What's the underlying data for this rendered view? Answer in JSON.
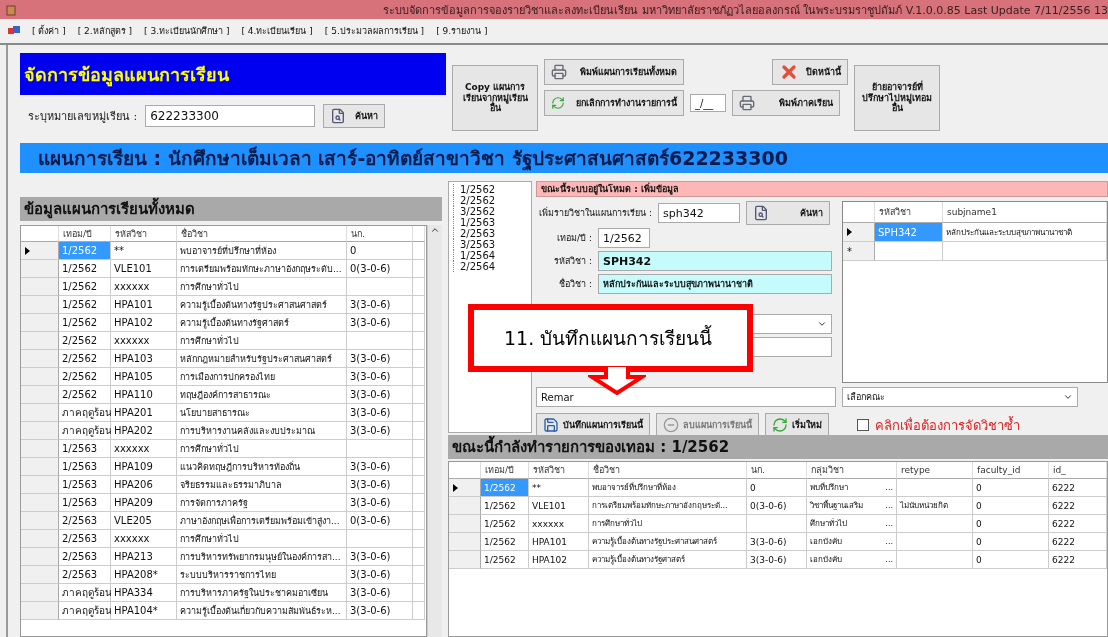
{
  "title_bar": {
    "title": "ระบบจัดการข้อมูลการจองรายวิชาและลงทะเบียนเรียน มหาวิทยาลัยราชภัฏวไลยอลงกรณ์ ในพระบรมราชูปถัมภ์ V.1.0.0.85 Last Update 7/11/2556 13"
  },
  "menu": [
    "[ ตั้งค่า ]",
    "[ 2.หลักสูตร ]",
    "[ 3.ทะเบียนนักศึกษา ]",
    "[ 4.ทะเบียนเรียน ]",
    "[ 5.ประมวลผลการเรียน ]",
    "[ 9.รายงาน ]"
  ],
  "header": {
    "title": "จัดการข้อมูลแผนการเรียน",
    "group_label": "ระบุหมายเลขหมู่เรียน :",
    "group_value": "622233300",
    "search_button": "ค้นหา"
  },
  "toolbar": {
    "copy_button": "Copy แผนการเรียนจากหมู่เรียนอื่น",
    "print_all_button": "พิมพ์แผนการเรียนทั้งหมด",
    "cancel_button": "ยกเลิกการทำงานรายการนี้",
    "term_field": "_/__",
    "print_term_button": "พิมพ์ภาคเรียน",
    "close_button": "ปิดหน้านี้",
    "move_button": "ย้ายอาจารย์ที่ปรึกษาไปหมู่เทอมอื่น"
  },
  "banner": "แผนการเรียน : นักศึกษาเต็มเวลา เสาร์-อาทิตย์สาขาวิชา รัฐประศาสนศาสตร์622233300",
  "all_plans": {
    "title": "ข้อมูลแผนการเรียนทั้งหมด",
    "columns": [
      "เทอม/ปี",
      "รหัสวิชา",
      "ชื่อวิชา",
      "นก."
    ],
    "rows": [
      {
        "term": "1/2562",
        "code": "**",
        "name": "พบอาจารย์ที่ปรึกษาที่ห้อง",
        "credits": "0",
        "selected": true
      },
      {
        "term": "1/2562",
        "code": "VLE101",
        "name": "การเตรียมพร้อมทักษะภาษาอังกฤษระดับ...",
        "credits": "0(3-0-6)",
        "selected": false
      },
      {
        "term": "1/2562",
        "code": "xxxxxx",
        "name": "การศึกษาทั่วไป",
        "selected": false
      },
      {
        "term": "1/2562",
        "code": "HPA101",
        "name": "ความรู้เบื้องต้นทางรัฐประศาสนศาสตร์",
        "credits": "3(3-0-6)",
        "selected": false
      },
      {
        "term": "1/2562",
        "code": "HPA102",
        "name": "ความรู้เบื้องต้นทางรัฐศาสตร์",
        "credits": "3(3-0-6)",
        "selected": false
      },
      {
        "term": "2/2562",
        "code": "xxxxxx",
        "name": "การศึกษาทั่วไป",
        "selected": false
      },
      {
        "term": "2/2562",
        "code": "HPA103",
        "name": "หลักกฎหมายสำหรับรัฐประศาสนศาสตร์",
        "credits": "3(3-0-6)",
        "selected": false
      },
      {
        "term": "2/2562",
        "code": "HPA105",
        "name": "การเมืองการปกครองไทย",
        "credits": "3(3-0-6)",
        "selected": false
      },
      {
        "term": "2/2562",
        "code": "HPA110",
        "name": "ทฤษฎีองค์การสาธารณะ",
        "credits": "3(3-0-6)",
        "selected": false
      },
      {
        "term": "ภาคฤดูร้อน",
        "code": "HPA201",
        "name": "นโยบายสาธารณะ",
        "credits": "3(3-0-6)",
        "selected": false
      },
      {
        "term": "ภาคฤดูร้อน",
        "code": "HPA202",
        "name": "การบริหารงานคลังและงบประมาณ",
        "credits": "3(3-0-6)",
        "selected": false
      },
      {
        "term": "1/2563",
        "code": "xxxxxx",
        "name": "การศึกษาทั่วไป",
        "selected": false
      },
      {
        "term": "1/2563",
        "code": "HPA109",
        "name": "แนวคิดทฤษฎีการบริหารท้องถิ่น",
        "credits": "3(3-0-6)",
        "selected": false
      },
      {
        "term": "1/2563",
        "code": "HPA206",
        "name": "จริยธรรมและธรรมาภิบาล",
        "credits": "3(3-0-6)",
        "selected": false
      },
      {
        "term": "1/2563",
        "code": "HPA209",
        "name": "การจัดการภาครัฐ",
        "credits": "3(3-0-6)",
        "selected": false
      },
      {
        "term": "2/2563",
        "code": "VLE205",
        "name": "ภาษาอังกฤษเพื่อการเตรียมพร้อมเข้าสู่งา...",
        "credits": "0(3-0-6)",
        "selected": false
      },
      {
        "term": "2/2563",
        "code": "xxxxxx",
        "name": "การศึกษาทั่วไป",
        "selected": false
      },
      {
        "term": "2/2563",
        "code": "HPA213",
        "name": "การบริหารทรัพยากรมนุษย์ในองค์การสา...",
        "credits": "3(3-0-6)",
        "selected": false
      },
      {
        "term": "2/2563",
        "code": "HPA208*",
        "name": "ระบบบริหารราชการไทย",
        "credits": "3(3-0-6)",
        "selected": false
      },
      {
        "term": "ภาคฤดูร้อน",
        "code": "HPA334",
        "name": "การบริหารภาครัฐในประชาคมอาเซียน",
        "credits": "3(3-0-6)",
        "selected": false
      },
      {
        "term": "ภาคฤดูร้อน",
        "code": "HPA104*",
        "name": "ความรู้เบื้องต้นเกี่ยวกับความสัมพันธ์ระห...",
        "credits": "3(3-0-6)",
        "selected": false
      }
    ]
  },
  "terms_tree": [
    "1/2562",
    "2/2562",
    "3/2562",
    "1/2563",
    "2/2563",
    "3/2563",
    "1/2564",
    "2/2564"
  ],
  "form": {
    "mode": "ขณะนี้ระบบอยู่ในโหมด : เพิ่มข้อมูล",
    "add_label": "เพิ่มรายวิชาในแผนการเรียน :",
    "add_value": "sph342",
    "search_button": "ค้นหา",
    "term_label": "เทอม/ปี :",
    "term_value": "1/2562",
    "code_label": "รหัสวิชา :",
    "code_value": "SPH342",
    "name_label": "ชื่อวิชา :",
    "name_value": "หลักประกันและระบบสุขภาพนานาชาติ",
    "remark_value": "Remar",
    "faculty_select": "เลือกคณะ",
    "buttons": [
      {
        "kind": "save",
        "label": "บันทึกแผนการเรียนนี้",
        "disabled": false
      },
      {
        "kind": "delete",
        "label": "ลบแผนการเรียนนี้",
        "disabled": true
      },
      {
        "kind": "refresh",
        "label": "เริ่มใหม่",
        "disabled": false
      }
    ],
    "repeat_checkbox": {
      "label": "คลิกเพื่อต้องการจัดวิชาซ้ำ",
      "checked": false
    }
  },
  "search_results": {
    "columns": [
      "รหัสวิชา",
      "subjname1"
    ],
    "new_row_mark": "*",
    "rows": [
      {
        "code": "SPH342",
        "name": "หลักประกันและระบบสุขภาพนานาชาติ",
        "selected": true
      }
    ]
  },
  "callout": "11. บันทึกแผนการเรียนนี้",
  "current_term": {
    "title": "ขณะนี้กำลังทำรายการของเทอม : 1/2562",
    "columns": [
      "เทอม/ปี",
      "รหัสวิชา",
      "ชื่อวิชา",
      "นก.",
      "กลุ่มวิชา",
      "retype",
      "faculty_id",
      "id_"
    ],
    "rows": [
      {
        "term": "1/2562",
        "code": "**",
        "name": "พบอาจารย์ที่ปรึกษาที่ห้อง",
        "credits": "0",
        "group": "พบที่ปรึกษา",
        "picker": "...",
        "faculty_id": "0",
        "id": "6222",
        "selected": true
      },
      {
        "term": "1/2562",
        "code": "VLE101",
        "name": "การเตรียมพร้อมทักษะภาษาอังกฤษระดั...",
        "credits": "0(3-0-6)",
        "group": "วิชาพื้นฐานเสริม",
        "picker": "...",
        "retype": "ไม่นับหน่วยกิต",
        "faculty_id": "0",
        "id": "6222",
        "selected": false
      },
      {
        "term": "1/2562",
        "code": "xxxxxx",
        "name": "การศึกษาทั่วไป",
        "group": "ศึกษาทั่วไป",
        "picker": "...",
        "faculty_id": "0",
        "id": "6222",
        "selected": false
      },
      {
        "term": "1/2562",
        "code": "HPA101",
        "name": "ความรู้เบื้องต้นทางรัฐประศาสนศาสตร์",
        "credits": "3(3-0-6)",
        "group": "เอกบังคับ",
        "picker": "...",
        "faculty_id": "0",
        "id": "6222",
        "selected": false
      },
      {
        "term": "1/2562",
        "code": "HPA102",
        "name": "ความรู้เบื้องต้นทางรัฐศาสตร์",
        "credits": "3(3-0-6)",
        "group": "เอกบังคับ",
        "picker": "...",
        "faculty_id": "0",
        "id": "6222",
        "selected": false
      }
    ]
  }
}
